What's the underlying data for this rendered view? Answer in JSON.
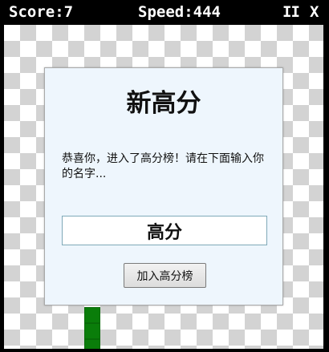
{
  "hud": {
    "score_text": "Score:7",
    "speed_text": "Speed:444",
    "pause_label": "II",
    "close_label": "X"
  },
  "dialog": {
    "title": "新高分",
    "message": "恭喜你，进入了高分榜！请在下面输入你的名字...",
    "name_value": "高分",
    "submit_label": "加入高分榜"
  },
  "colors": {
    "board_light": "#ffffff",
    "board_dark": "#d3d3d3",
    "snake": "#0a7d0a",
    "dialog_bg": "#eef6fd"
  }
}
